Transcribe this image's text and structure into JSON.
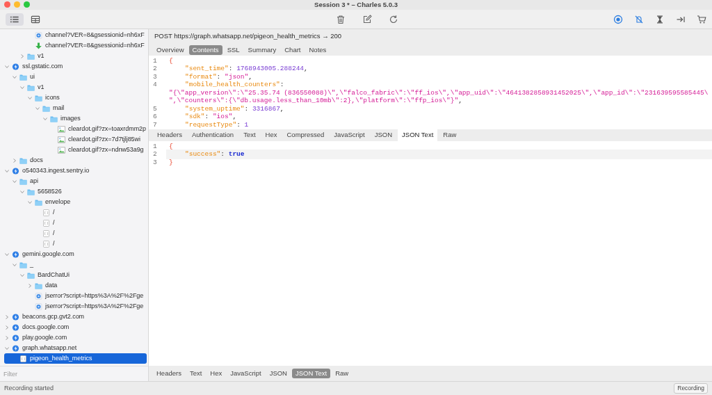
{
  "window": {
    "title": "Session 3 * – Charles 5.0.3"
  },
  "view_buttons": [
    {
      "kind": "list",
      "selected": true
    },
    {
      "kind": "table",
      "selected": false
    }
  ],
  "tree": [
    {
      "children": [
        {
          "children": [
            {
              "children": [
                {
                  "label": "channel?VER=8&gsessionid=nh6xF",
                  "kind": "request",
                  "selected": false
                },
                {
                  "label": "channel?VER=8&gsessionid=nh6xF",
                  "kind": "download",
                  "selected": false
                }
              ]
            },
            {
              "label": "v1",
              "kind": "folder",
              "expanded": false,
              "selected": false
            }
          ]
        }
      ]
    },
    {
      "label": "ssl.gstatic.com",
      "kind": "host",
      "expanded": true,
      "selected": false,
      "children": [
        {
          "label": "ui",
          "kind": "folder",
          "expanded": true,
          "selected": false,
          "children": [
            {
              "label": "v1",
              "kind": "folder",
              "expanded": true,
              "selected": false,
              "children": [
                {
                  "label": "icons",
                  "kind": "folder",
                  "expanded": true,
                  "selected": false,
                  "children": [
                    {
                      "label": "mail",
                      "kind": "folder",
                      "expanded": true,
                      "selected": false,
                      "children": [
                        {
                          "label": "images",
                          "kind": "folder",
                          "expanded": true,
                          "selected": false,
                          "children": [
                            {
                              "label": "cleardot.gif?zx=toaxrdmm2p",
                              "kind": "image",
                              "selected": false
                            },
                            {
                              "label": "cleardot.gif?zx=7d7tjlj85wi",
                              "kind": "image",
                              "selected": false
                            },
                            {
                              "label": "cleardot.gif?zx=ndnw53a9g",
                              "kind": "image",
                              "selected": false
                            }
                          ]
                        }
                      ]
                    }
                  ]
                }
              ]
            }
          ]
        },
        {
          "label": "docs",
          "kind": "folder",
          "expanded": false,
          "selected": false
        }
      ]
    },
    {
      "label": "o540343.ingest.sentry.io",
      "kind": "host",
      "expanded": true,
      "selected": false,
      "children": [
        {
          "label": "api",
          "kind": "folder",
          "expanded": true,
          "selected": false,
          "children": [
            {
              "label": "5658526",
              "kind": "folder",
              "expanded": true,
              "selected": false,
              "children": [
                {
                  "label": "envelope",
                  "kind": "folder",
                  "expanded": true,
                  "selected": false,
                  "children": [
                    {
                      "label": "/",
                      "kind": "json",
                      "selected": false
                    },
                    {
                      "label": "/",
                      "kind": "json",
                      "selected": false
                    },
                    {
                      "label": "/",
                      "kind": "json",
                      "selected": false
                    },
                    {
                      "label": "/",
                      "kind": "json",
                      "selected": false
                    }
                  ]
                }
              ]
            }
          ]
        }
      ]
    },
    {
      "label": "gemini.google.com",
      "kind": "host",
      "expanded": true,
      "selected": false,
      "children": [
        {
          "label": "_",
          "kind": "folder",
          "expanded": true,
          "selected": false,
          "children": [
            {
              "label": "BardChatUi",
              "kind": "folder",
              "expanded": true,
              "selected": false,
              "children": [
                {
                  "label": "data",
                  "kind": "folder",
                  "expanded": false,
                  "selected": false
                },
                {
                  "label": "jserror?script=https%3A%2F%2Fge",
                  "kind": "request",
                  "selected": false
                },
                {
                  "label": "jserror?script=https%3A%2F%2Fge",
                  "kind": "request",
                  "selected": false
                }
              ]
            }
          ]
        }
      ]
    },
    {
      "label": "beacons.gcp.gvt2.com",
      "kind": "host",
      "expanded": false,
      "selected": false
    },
    {
      "label": "docs.google.com",
      "kind": "host",
      "expanded": false,
      "selected": false
    },
    {
      "label": "play.google.com",
      "kind": "host",
      "expanded": false,
      "selected": false
    },
    {
      "label": "graph.whatsapp.net",
      "kind": "host",
      "expanded": true,
      "selected": false,
      "children": [
        {
          "label": "pigeon_health_metrics",
          "kind": "json",
          "selected": true
        }
      ]
    }
  ],
  "filter": {
    "placeholder": "Filter"
  },
  "request": {
    "summary": "POST https://graph.whatsapp.net/pigeon_health_metrics → 200",
    "tabs": [
      {
        "label": "Overview",
        "selected": false
      },
      {
        "label": "Contents",
        "selected": true
      },
      {
        "label": "SSL",
        "selected": false
      },
      {
        "label": "Summary",
        "selected": false
      },
      {
        "label": "Chart",
        "selected": false
      },
      {
        "label": "Notes",
        "selected": false
      }
    ],
    "code": [
      {
        "number": "1",
        "tokens": [
          {
            "kind": "brace",
            "text": "{"
          }
        ]
      },
      {
        "number": "2",
        "indented": true,
        "tokens": [
          {
            "kind": "key",
            "text": "\"sent_time\""
          },
          {
            "kind": "punct",
            "text": ": "
          },
          {
            "kind": "number",
            "text": "1768943005.288244"
          },
          {
            "kind": "punct",
            "text": ","
          }
        ]
      },
      {
        "number": "3",
        "indented": true,
        "tokens": [
          {
            "kind": "key",
            "text": "\"format\""
          },
          {
            "kind": "punct",
            "text": ": "
          },
          {
            "kind": "string",
            "text": "\"json\""
          },
          {
            "kind": "punct",
            "text": ","
          }
        ]
      },
      {
        "number": "4",
        "indented": true,
        "tokens": [
          {
            "kind": "key",
            "text": "\"mobile_health_counters\""
          },
          {
            "kind": "punct",
            "text": ":"
          }
        ]
      },
      {
        "tokens": [
          {
            "kind": "string",
            "text": "\"{\\\"app_version\\\":\\\"25.35.74 (836550088)\\\",\\\"falco_fabric\\\":\\\"ff_ios\\\",\\\"app_uid\\\":\\\"4641382858931452025\\\",\\\"app_id\\\":\\\"231639595585445\\"
          }
        ]
      },
      {
        "tokens": [
          {
            "kind": "string",
            "text": "\",\\\"counters\\\":{\\\"db.usage.less_than_10mb\\\":2},\\\"platform\\\":\\\"ffp_ios\\\"}\""
          },
          {
            "kind": "punct",
            "text": ","
          }
        ]
      },
      {
        "number": "5",
        "indented": true,
        "tokens": [
          {
            "kind": "key",
            "text": "\"system_uptime\""
          },
          {
            "kind": "punct",
            "text": ": "
          },
          {
            "kind": "number",
            "text": "3316867"
          },
          {
            "kind": "punct",
            "text": ","
          }
        ]
      },
      {
        "number": "6",
        "indented": true,
        "tokens": [
          {
            "kind": "key",
            "text": "\"sdk\""
          },
          {
            "kind": "punct",
            "text": ": "
          },
          {
            "kind": "string",
            "text": "\"ios\""
          },
          {
            "kind": "punct",
            "text": ","
          }
        ]
      },
      {
        "number": "7",
        "indented": true,
        "tokens": [
          {
            "kind": "key",
            "text": "\"requestType\""
          },
          {
            "kind": "punct",
            "text": ": "
          },
          {
            "kind": "number",
            "text": "1"
          }
        ]
      }
    ]
  },
  "response": {
    "tabs": [
      {
        "label": "Headers",
        "selected": false
      },
      {
        "label": "Authentication",
        "selected": false
      },
      {
        "label": "Text",
        "selected": false
      },
      {
        "label": "Hex",
        "selected": false
      },
      {
        "label": "Compressed",
        "selected": false
      },
      {
        "label": "JavaScript",
        "selected": false
      },
      {
        "label": "JSON",
        "selected": false
      },
      {
        "label": "JSON Text",
        "selected": true
      },
      {
        "label": "Raw",
        "selected": false
      }
    ],
    "code": [
      {
        "number": "1",
        "current": false,
        "tokens": [
          {
            "kind": "brace",
            "text": "{"
          }
        ]
      },
      {
        "number": "2",
        "current": true,
        "indented": true,
        "tokens": [
          {
            "kind": "key",
            "text": "\"success\""
          },
          {
            "kind": "punct",
            "text": ": "
          },
          {
            "kind": "bool",
            "text": "true"
          }
        ]
      },
      {
        "number": "3",
        "current": false,
        "tokens": [
          {
            "kind": "brace",
            "text": "}"
          }
        ]
      }
    ]
  },
  "bottom_tabs": [
    {
      "label": "Headers",
      "selected": false
    },
    {
      "label": "Text",
      "selected": false
    },
    {
      "label": "Hex",
      "selected": false
    },
    {
      "label": "JavaScript",
      "selected": false
    },
    {
      "label": "JSON",
      "selected": false
    },
    {
      "label": "JSON Text",
      "selected": true
    },
    {
      "label": "Raw",
      "selected": false
    }
  ],
  "status_bar": {
    "message": "Recording started",
    "button": "Recording"
  }
}
